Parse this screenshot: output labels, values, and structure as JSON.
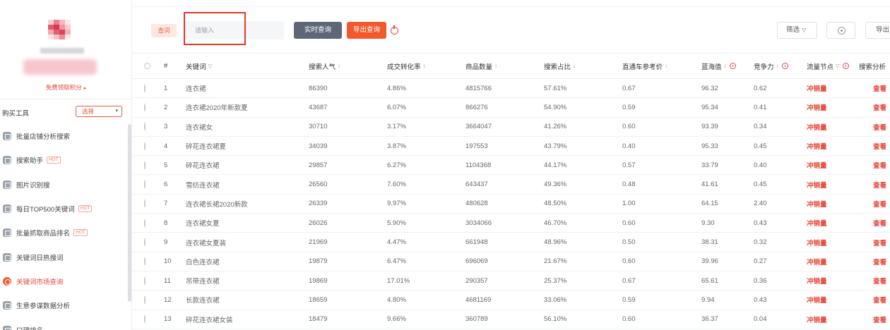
{
  "colors": {
    "accent": "#f3582c",
    "primary_button": "#5d6778",
    "link_red": "#e8473a",
    "icon_gray": "#9aa1a9"
  },
  "sidebar": {
    "promo_link": "免费领取积分",
    "tool_label": "购买工具",
    "tool_select": "选择",
    "menu": [
      {
        "label": "批量店铺分析搜索",
        "badge": "",
        "icon": "store-icon",
        "active": false
      },
      {
        "label": "搜索助手",
        "badge": "HOT",
        "icon": "search-icon",
        "active": false
      },
      {
        "label": "图片识别搜",
        "badge": "",
        "icon": "image-icon",
        "active": false
      },
      {
        "label": "每日TOP500关键词",
        "badge": "HOT",
        "icon": "list-icon",
        "active": false
      },
      {
        "label": "批量抓取商品排名",
        "badge": "HOT",
        "icon": "ranking-icon",
        "active": false
      },
      {
        "label": "关键词日热搜词",
        "badge": "",
        "icon": "fire-icon",
        "active": false
      },
      {
        "label": "关键词市场查询",
        "badge": "",
        "icon": "market-icon",
        "active": true
      },
      {
        "label": "生意参谋数据分析",
        "badge": "",
        "icon": "data-icon",
        "active": false
      },
      {
        "label": "口碑排名",
        "badge": "",
        "icon": "star-icon",
        "active": false
      }
    ]
  },
  "toolbar": {
    "tag": "查词",
    "search_placeholder": "请输入",
    "realtime_button": "实时查询",
    "export_query_button": "导出查询",
    "filter_button": "筛选",
    "export_button": "导出"
  },
  "table": {
    "columns": [
      {
        "label": "#"
      },
      {
        "label": "关键词",
        "filter": true
      },
      {
        "label": "搜索人气",
        "sort": true
      },
      {
        "label": "成交转化率",
        "sort": true
      },
      {
        "label": "商品数量",
        "sort": true
      },
      {
        "label": "搜索占比",
        "sort": true
      },
      {
        "label": "直通车参考价",
        "sort": true
      },
      {
        "label": "蓝海值",
        "sort": true,
        "info": true
      },
      {
        "label": "竞争力",
        "sort": true,
        "info": true
      },
      {
        "label": "流量节点",
        "filter": true,
        "info": true
      },
      {
        "label": "搜索分析"
      }
    ],
    "rows": [
      [
        "1",
        "连衣裙",
        "86390",
        "4.86%",
        "4815766",
        "57.61%",
        "0.67",
        "96.32",
        "0.62",
        "冲销量",
        "查看"
      ],
      [
        "2",
        "连衣裙2020年新款夏",
        "43687",
        "6.07%",
        "866276",
        "54.90%",
        "0.59",
        "95.34",
        "0.41",
        "冲销量",
        "查看"
      ],
      [
        "3",
        "连衣裙女",
        "30710",
        "3.17%",
        "3664047",
        "41.26%",
        "0.60",
        "93.39",
        "0.34",
        "冲销量",
        "查看"
      ],
      [
        "4",
        "碎花连衣裙夏",
        "34039",
        "3.87%",
        "197553",
        "43.79%",
        "0.40",
        "95.33",
        "0.45",
        "冲销量",
        "查看"
      ],
      [
        "5",
        "碎花连衣裙",
        "29857",
        "6.27%",
        "1104368",
        "44.17%",
        "0.57",
        "33.79",
        "0.40",
        "冲销量",
        "查看"
      ],
      [
        "6",
        "雪纺连衣裙",
        "26560",
        "7.60%",
        "643437",
        "49.36%",
        "0.48",
        "41.61",
        "0.45",
        "冲销量",
        "查看"
      ],
      [
        "7",
        "连衣裙长裙2020新款",
        "26339",
        "9.97%",
        "480628",
        "48.50%",
        "1.00",
        "64.15",
        "2.40",
        "冲销量",
        "查看"
      ],
      [
        "8",
        "连衣裙女夏",
        "26026",
        "5.90%",
        "3034066",
        "46.70%",
        "0.60",
        "9.30",
        "0.43",
        "冲销量",
        "查看"
      ],
      [
        "9",
        "连衣裙女夏装",
        "21969",
        "4.47%",
        "661948",
        "48.96%",
        "0.50",
        "38.31",
        "0.32",
        "冲销量",
        "查看"
      ],
      [
        "10",
        "白色连衣裙",
        "19879",
        "6.47%",
        "696069",
        "21.67%",
        "0.60",
        "39.96",
        "0.27",
        "冲销量",
        "查看"
      ],
      [
        "11",
        "吊带连衣裙",
        "19869",
        "17.01%",
        "290357",
        "25.37%",
        "0.67",
        "65.61",
        "0.36",
        "冲销量",
        "查看"
      ],
      [
        "12",
        "长款连衣裙",
        "18659",
        "4.80%",
        "4681169",
        "33.06%",
        "0.59",
        "9.94",
        "0.43",
        "冲销量",
        "查看"
      ],
      [
        "13",
        "碎花连衣裙女装",
        "18479",
        "9.66%",
        "360789",
        "56.10%",
        "0.60",
        "36.37",
        "0.04",
        "冲销量",
        "查看"
      ]
    ]
  }
}
